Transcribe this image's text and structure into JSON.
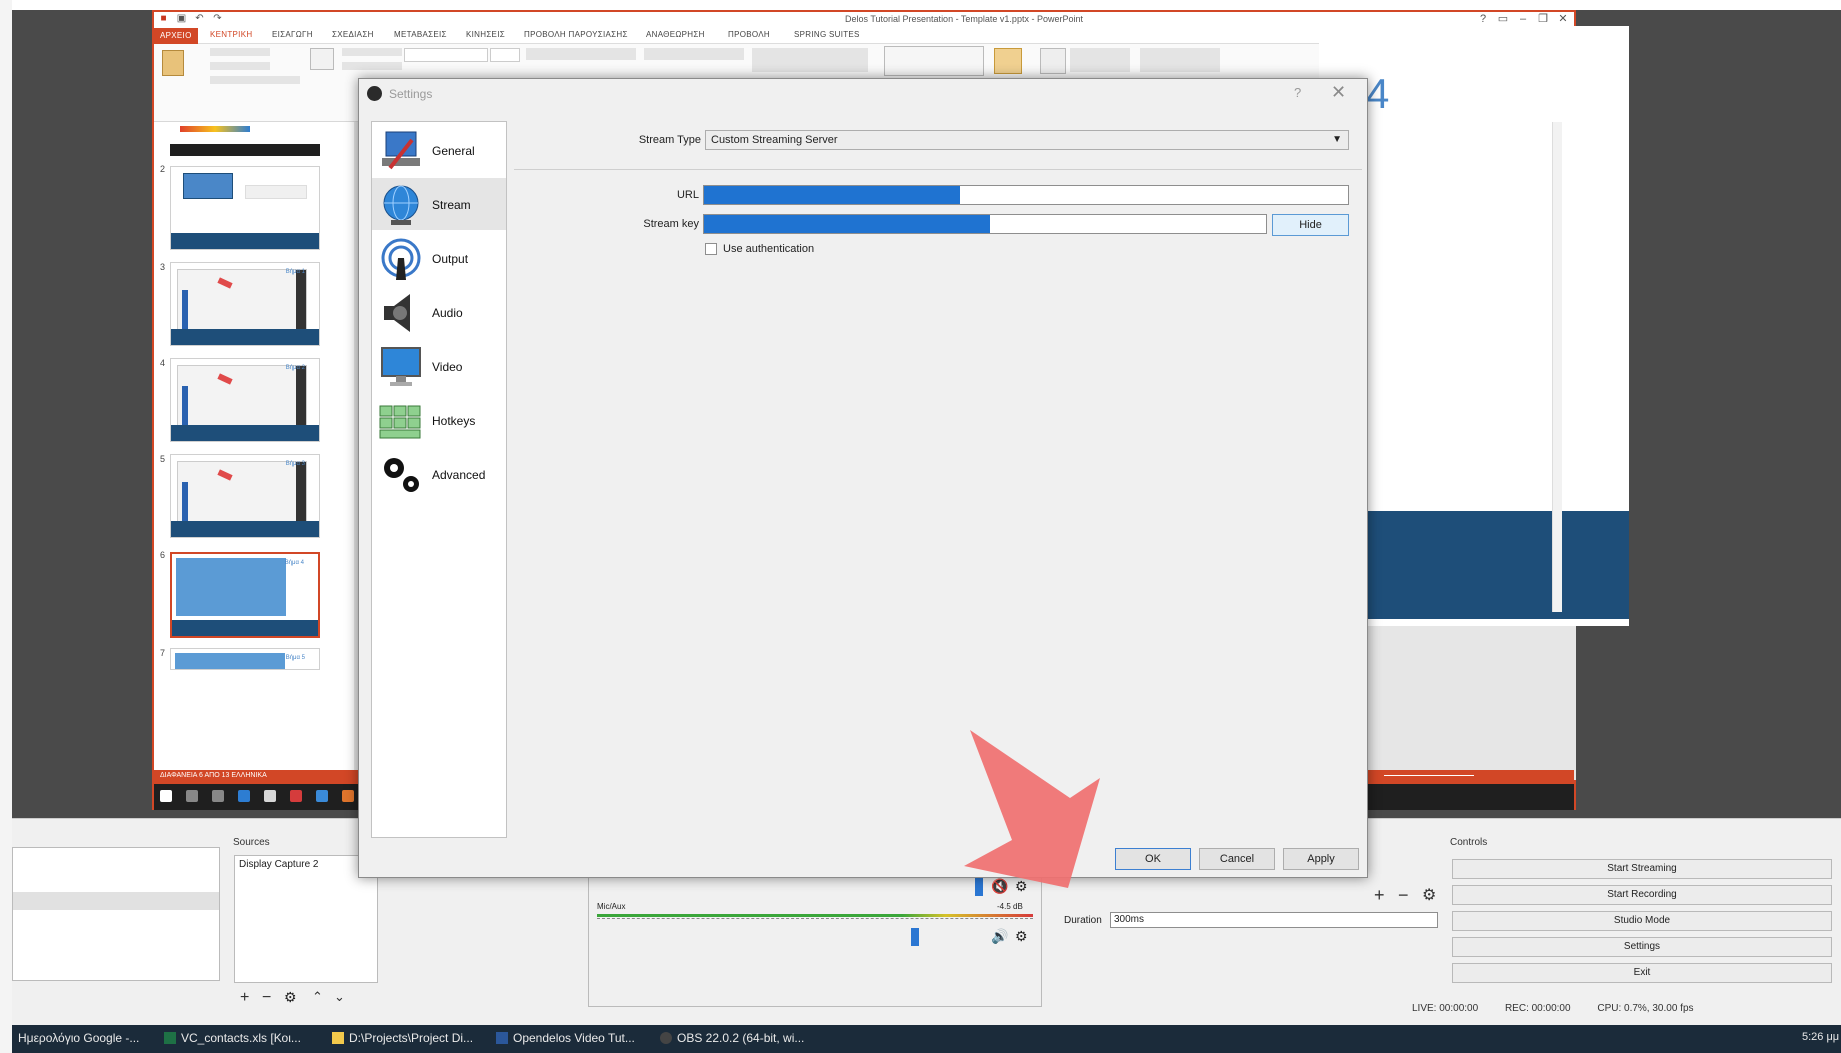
{
  "powerpoint": {
    "title": "Delos Tutorial Presentation - Template v1.pptx - PowerPoint",
    "tabs": [
      "ΑΡΧΕΙΟ",
      "ΚΕΝΤΡΙΚΗ",
      "ΕΙΣΑΓΩΓΗ",
      "ΣΧΕΔΙΑΣΗ",
      "ΜΕΤΑΒΑΣΕΙΣ",
      "ΚΙΝΗΣΕΙΣ",
      "ΠΡΟΒΟΛΗ ΠΑΡΟΥΣΙΑΣΗΣ",
      "ΑΝΑΘΕΩΡΗΣΗ",
      "ΠΡΟΒΟΛΗ",
      "SPRING SUITES"
    ],
    "slides": [
      {
        "num": "2",
        "label": ""
      },
      {
        "num": "3",
        "label": "Βήμα 1"
      },
      {
        "num": "4",
        "label": "Βήμα 2"
      },
      {
        "num": "5",
        "label": "Βήμα 3"
      },
      {
        "num": "6",
        "label": "Βήμα 4"
      },
      {
        "num": "7",
        "label": "Βήμα 5"
      }
    ],
    "slide_number_big": "4",
    "status": "ΔΙΑΦΑΝΕΙΑ 6 ΑΠΟ 13   ΕΛΛΗΝΙΚΑ"
  },
  "settings": {
    "title": "Settings",
    "help": "?",
    "close": "✕",
    "nav": [
      "General",
      "Stream",
      "Output",
      "Audio",
      "Video",
      "Hotkeys",
      "Advanced"
    ],
    "stream_type_label": "Stream Type",
    "stream_type_value": "Custom Streaming Server",
    "url_label": "URL",
    "stream_key_label": "Stream key",
    "hide_button": "Hide",
    "use_auth_label": "Use authentication",
    "ok": "OK",
    "cancel": "Cancel",
    "apply": "Apply"
  },
  "obs": {
    "sources_title": "Sources",
    "source_item": "Display Capture 2",
    "controls_title": "Controls",
    "controls": [
      "Start Streaming",
      "Start Recording",
      "Studio Mode",
      "Settings",
      "Exit"
    ],
    "duration_label": "Duration",
    "duration_value": "300ms",
    "mic_label": "Mic/Aux",
    "mic_db": "-4.5 dB",
    "status": {
      "live": "LIVE: 00:00:00",
      "rec": "REC: 00:00:00",
      "cpu": "CPU: 0.7%, 30.00 fps"
    }
  },
  "taskbar": {
    "items": [
      "Ημερολόγιο Google -...",
      "VC_contacts.xls [Κοι...",
      "D:\\Projects\\Project Di...",
      "Opendelos Video Tut...",
      "OBS 22.0.2 (64-bit, wi..."
    ],
    "clock": "5:26 μμ"
  }
}
